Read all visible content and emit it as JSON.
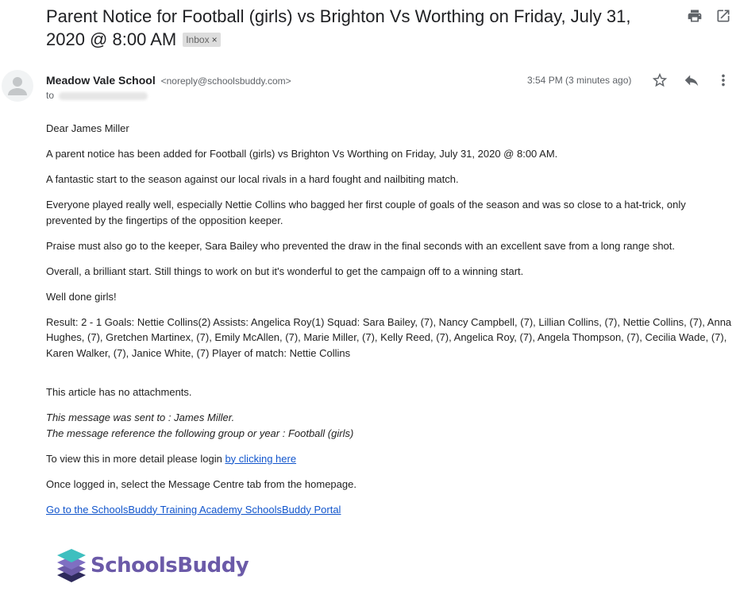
{
  "email": {
    "subject": "Parent Notice for Football (girls) vs Brighton Vs Worthing on Friday, July 31, 2020 @ 8:00 AM",
    "label_chip": "Inbox",
    "label_remove": "×",
    "sender_name": "Meadow Vale School",
    "sender_email": "<noreply@schoolsbuddy.com>",
    "to_prefix": "to",
    "time": "3:54 PM (3 minutes ago)",
    "icons": {
      "print": "print-icon",
      "open_new_window": "open-in-new-window-icon",
      "star": "star-icon",
      "reply": "reply-icon",
      "more": "more-vertical-icon",
      "avatar": "person-avatar-icon"
    }
  },
  "body": {
    "greeting": "Dear James Miller",
    "p1": "A parent notice has been added for Football (girls) vs Brighton Vs Worthing on Friday, July 31, 2020 @ 8:00 AM.",
    "p2": "A fantastic start to the season against our local rivals in a hard fought and nailbiting match.",
    "p3": "Everyone played really well, especially Nettie Collins who bagged her first couple of goals of the season and was so close to a hat-trick, only prevented by the fingertips of the opposition keeper.",
    "p4": "Praise must also go to the keeper, Sara Bailey who prevented the draw in the final seconds with an excellent save from a long range shot.",
    "p5": "Overall, a brilliant start. Still things to work on but it's wonderful to get the campaign off to a winning start.",
    "p6": "Well done girls!",
    "result": "Result: 2 - 1 Goals: Nettie Collins(2) Assists: Angelica Roy(1) Squad: Sara Bailey, (7), Nancy Campbell, (7), Lillian Collins, (7), Nettie Collins, (7), Anna Hughes, (7), Gretchen Martinex, (7), Emily McAllen, (7), Marie Miller, (7), Kelly Reed, (7), Angelica Roy, (7), Angela Thompson, (7), Cecilia Wade, (7), Karen Walker, (7), Janice White, (7) Player of match: Nettie Collins",
    "attachments": "This article has no attachments.",
    "sent_to": "This message was sent to : James Miller.",
    "reference": "The message reference the following group or year : Football (girls)",
    "login_prefix": "To view this in more detail please login ",
    "login_link": "by clicking here",
    "once_logged": "Once logged in, select the Message Centre tab from the homepage.",
    "portal_link": "Go to the SchoolsBuddy Training Academy SchoolsBuddy Portal"
  },
  "footer": {
    "logo_text": "SchoolsBuddy",
    "logo_icon": "schoolsbuddy-layers-icon"
  },
  "colors": {
    "link": "#1155cc",
    "logo_purple": "#6b5aa8",
    "logo_teal": "#3ebfbf"
  }
}
